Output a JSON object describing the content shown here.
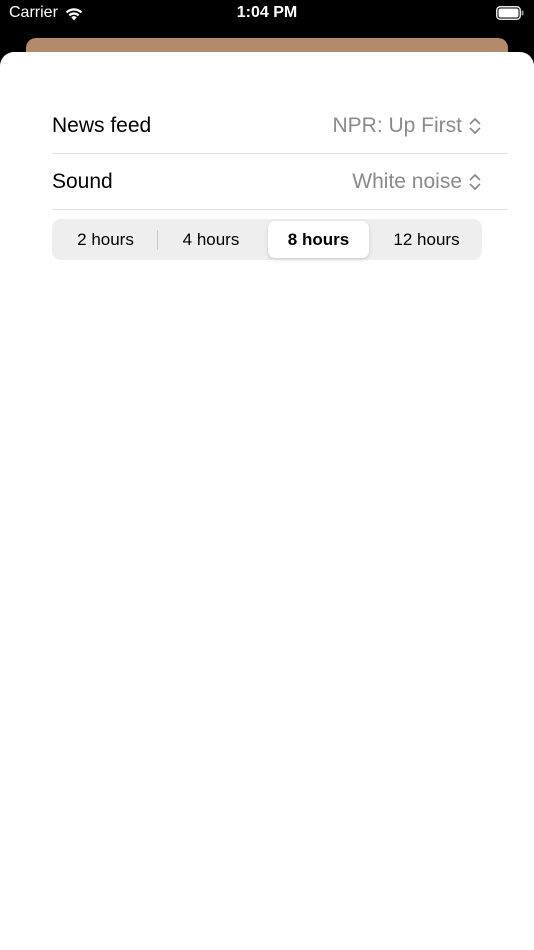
{
  "status_bar": {
    "carrier": "Carrier",
    "time": "1:04 PM",
    "icons": [
      "wifi-icon",
      "battery-icon"
    ]
  },
  "colors": {
    "background_card": "#b48a6b",
    "secondary_text": "#8a8a8e",
    "segmented_background": "#eeeeef"
  },
  "settings": {
    "news_feed": {
      "label": "News feed",
      "value": "NPR: Up First",
      "icon": "chevron-up-down-icon"
    },
    "sound": {
      "label": "Sound",
      "value": "White noise",
      "icon": "chevron-up-down-icon"
    }
  },
  "duration": {
    "options": [
      "2 hours",
      "4 hours",
      "8 hours",
      "12 hours"
    ],
    "selected": "8 hours"
  }
}
